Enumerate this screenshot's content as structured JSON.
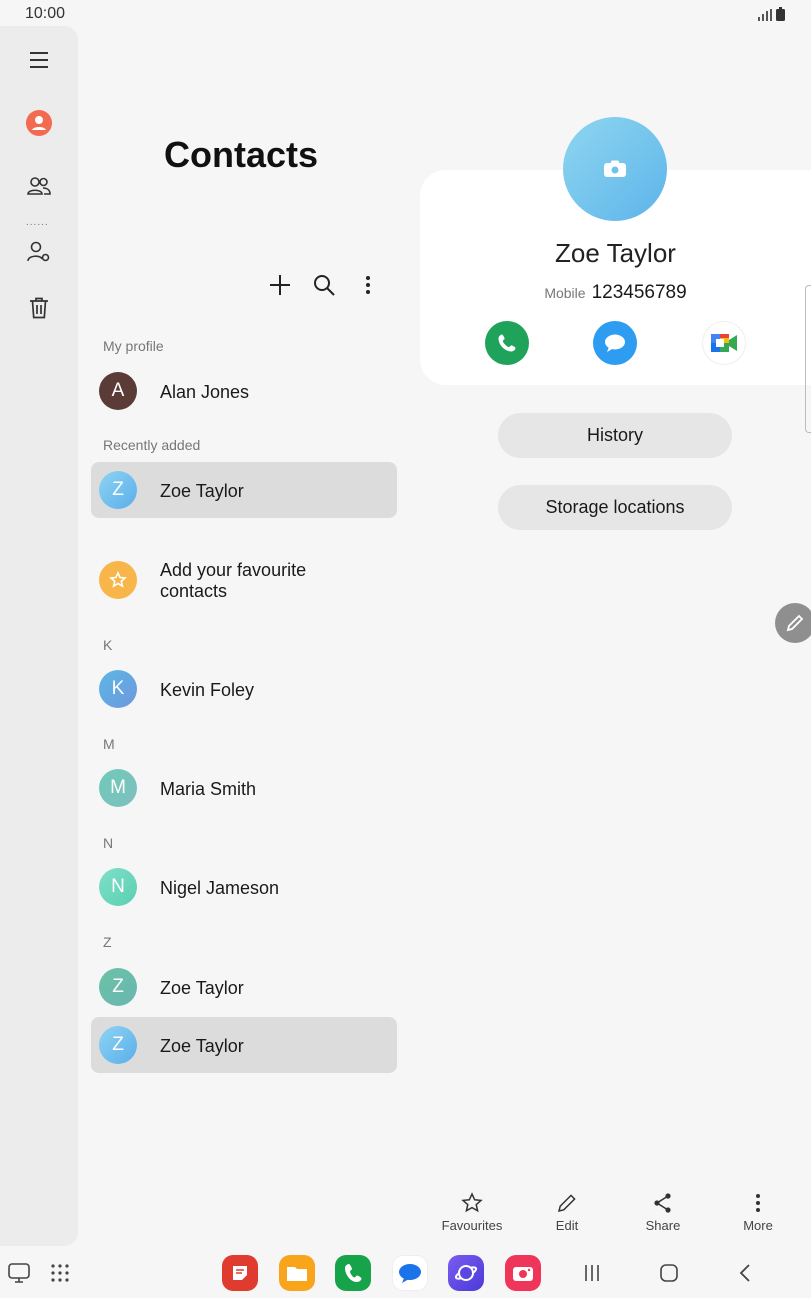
{
  "status_bar": {
    "time": "10:00"
  },
  "colors": {
    "accent_profile": "#f26a4f",
    "call_green": "#1fa25a",
    "message_blue": "#2e9cf0",
    "selected_row": "#dcdcdc"
  },
  "rail": {
    "items": [
      "menu-icon",
      "profile-icon",
      "contacts-group-icon",
      "manage-contacts-icon",
      "trash-icon"
    ],
    "separator": "......"
  },
  "list": {
    "title": "Contacts",
    "toolbar": [
      "add-icon",
      "search-icon",
      "more-vert-icon"
    ],
    "my_profile_label": "My profile",
    "my_profile": {
      "initial": "A",
      "name": "Alan Jones"
    },
    "recently_added_label": "Recently added",
    "recently_added": {
      "initial": "Z",
      "name": "Zoe Taylor"
    },
    "favourites_prompt": "Add your favourite contacts",
    "sections": [
      {
        "letter": "K",
        "contacts": [
          {
            "initial": "K",
            "name": "Kevin Foley"
          }
        ]
      },
      {
        "letter": "M",
        "contacts": [
          {
            "initial": "M",
            "name": "Maria Smith"
          }
        ]
      },
      {
        "letter": "N",
        "contacts": [
          {
            "initial": "N",
            "name": "Nigel Jameson"
          }
        ]
      },
      {
        "letter": "Z",
        "contacts": [
          {
            "initial": "Z",
            "name": "Zoe Taylor"
          },
          {
            "initial": "Z",
            "name": "Zoe Taylor"
          }
        ]
      }
    ]
  },
  "detail": {
    "name": "Zoe Taylor",
    "phone_label": "Mobile",
    "phone_number": "123456789",
    "actions": [
      "call-icon",
      "message-icon",
      "video-call-icon"
    ],
    "history_label": "History",
    "storage_label": "Storage locations"
  },
  "bottom_actions": [
    {
      "icon": "star-icon",
      "label": "Favourites"
    },
    {
      "icon": "pencil-icon",
      "label": "Edit"
    },
    {
      "icon": "share-icon",
      "label": "Share"
    },
    {
      "icon": "more-vert-icon",
      "label": "More"
    }
  ]
}
